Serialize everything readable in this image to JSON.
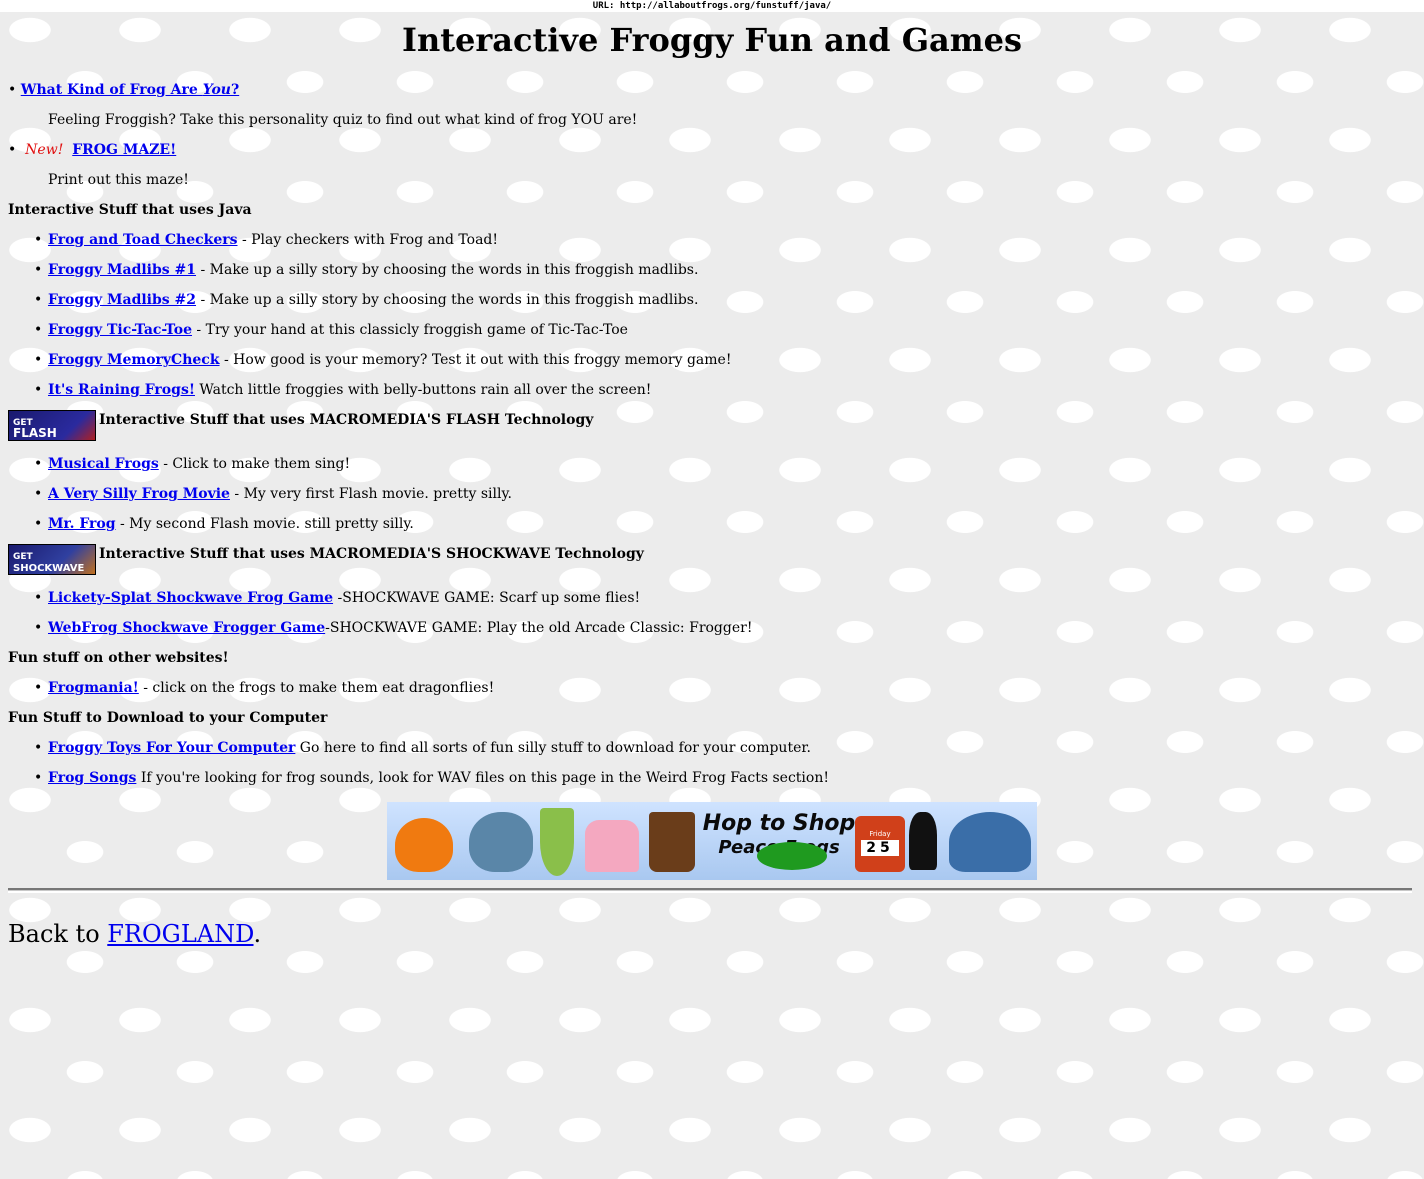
{
  "url_bar": {
    "label": "URL:",
    "url": "http://allaboutfrogs.org/funstuff/java/"
  },
  "page_title": "Interactive Froggy Fun and Games",
  "quiz": {
    "link": "What Kind of Frog Are ",
    "link_em": "You",
    "link_tail": "?",
    "desc": "Feeling Froggish? Take this personality quiz to find out what kind of frog YOU are!"
  },
  "maze": {
    "new_label": "New!",
    "link": "FROG MAZE!",
    "desc": "Print out this maze!"
  },
  "java": {
    "heading": "Interactive Stuff that uses Java",
    "items": [
      {
        "link": "Frog and Toad Checkers",
        "desc": " - Play checkers with Frog and Toad!"
      },
      {
        "link": "Froggy Madlibs #1",
        "desc": " - Make up a silly story by choosing the words in this froggish madlibs."
      },
      {
        "link": "Froggy Madlibs #2",
        "desc": " - Make up a silly story by choosing the words in this froggish madlibs."
      },
      {
        "link": "Froggy Tic-Tac-Toe",
        "desc": " - Try your hand at this classicly froggish game of Tic-Tac-Toe"
      },
      {
        "link": "Froggy MemoryCheck",
        "desc": " - How good is your memory? Test it out with this froggy memory game!"
      },
      {
        "link": "It's Raining Frogs!",
        "desc": " Watch little froggies with belly-buttons rain all over the screen!"
      }
    ]
  },
  "flash": {
    "badge_top": "GET",
    "badge_main": "FLASH",
    "heading": "Interactive Stuff that uses MACROMEDIA'S FLASH Technology",
    "items": [
      {
        "link": "Musical Frogs",
        "desc": " - Click to make them sing!"
      },
      {
        "link": "A Very Silly Frog Movie",
        "desc": " - My very first Flash movie. pretty silly."
      },
      {
        "link": "Mr. Frog",
        "desc": " - My second Flash movie. still pretty silly."
      }
    ]
  },
  "shockwave": {
    "badge_top": "GET",
    "badge_main": "SHOCKWAVE",
    "heading": "Interactive Stuff that uses MACROMEDIA'S SHOCKWAVE Technology",
    "items": [
      {
        "link": "Lickety-Splat Shockwave Frog Game",
        "desc": " -SHOCKWAVE GAME: Scarf up some flies!"
      },
      {
        "link": "WebFrog Shockwave Frogger Game",
        "desc": "-SHOCKWAVE GAME: Play the old Arcade Classic: Frogger!"
      }
    ]
  },
  "other_sites": {
    "heading": "Fun stuff on other websites!",
    "items": [
      {
        "link": "Frogmania!",
        "desc": " - click on the frogs to make them eat dragonflies!"
      }
    ]
  },
  "download": {
    "heading": "Fun Stuff to Download to your Computer",
    "items": [
      {
        "link": "Froggy Toys For Your Computer",
        "desc": " Go here to find all sorts of fun silly stuff to download for your computer."
      },
      {
        "link": "Frog Songs",
        "desc": " If you're looking for frog sounds, look for WAV files on this page in the Weird Frog Facts section!"
      }
    ]
  },
  "banner": {
    "line1": "Hop to Shop",
    "line2": "Peace Frogs",
    "calendar_day": "Friday",
    "calendar_date": "25"
  },
  "footer": {
    "prefix": "Back to ",
    "link": "FROGLAND",
    "suffix": "."
  },
  "colors": {
    "link": "#0000ee",
    "new": "#e01010",
    "background": "#ececec"
  }
}
